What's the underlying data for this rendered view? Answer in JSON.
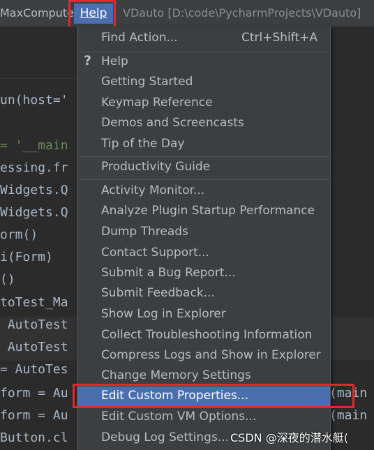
{
  "menubar": {
    "app_label": "MaxCompute",
    "help_label": "Help",
    "window_title": "VDauto [D:\\code\\PycharmProjects\\VDauto]"
  },
  "help_menu": {
    "items": [
      {
        "label": "Find Action...",
        "shortcut": "Ctrl+Shift+A"
      },
      {
        "label": "Help"
      },
      {
        "label": "Getting Started"
      },
      {
        "label": "Keymap Reference"
      },
      {
        "label": "Demos and Screencasts"
      },
      {
        "label": "Tip of the Day"
      },
      {
        "label": "Productivity Guide"
      },
      {
        "label": "Activity Monitor..."
      },
      {
        "label": "Analyze Plugin Startup Performance"
      },
      {
        "label": "Dump Threads"
      },
      {
        "label": "Contact Support..."
      },
      {
        "label": "Submit a Bug Report..."
      },
      {
        "label": "Submit Feedback..."
      },
      {
        "label": "Show Log in Explorer"
      },
      {
        "label": "Collect Troubleshooting Information"
      },
      {
        "label": "Compress Logs and Show in Explorer"
      },
      {
        "label": "Change Memory Settings"
      },
      {
        "label": "Edit Custom Properties..."
      },
      {
        "label": "Edit Custom VM Options..."
      },
      {
        "label": "Debug Log Settings..."
      }
    ],
    "selected": "Edit Custom Properties..."
  },
  "editor": {
    "lines": [
      "un(host='",
      "= '__main",
      "essing.fr",
      "Widgets.Q",
      "Widgets.Q",
      "orm()",
      "i(Form)",
      "()",
      "toTest_Ma",
      " AutoTest",
      " AutoTest",
      "= AutoTes",
      "form = Au",
      "form = Au",
      "Button.cl"
    ],
    "right_fragments": [
      "(main",
      "(main"
    ]
  },
  "watermark": "CSDN @深夜的潜水艇(",
  "colors": {
    "selection": "#4b6eaf",
    "menu_bg": "#3c3f41",
    "editor_bg": "#2b2b2b",
    "highlight_box": "#e0282e"
  }
}
